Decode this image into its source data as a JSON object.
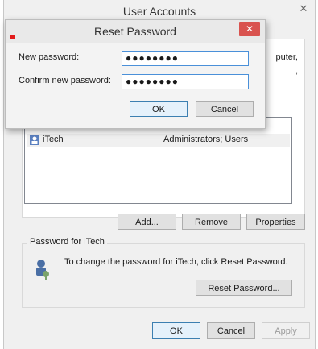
{
  "window": {
    "title": "User Accounts",
    "close_glyph": "✕"
  },
  "top_group": {
    "partial_line1": "puter,",
    "partial_line2": ","
  },
  "users": [
    {
      "name": "iTech",
      "groups": "Administrators; Users"
    }
  ],
  "buttons": {
    "add": "Add...",
    "remove": "Remove",
    "properties": "Properties"
  },
  "password_group": {
    "title": "Password for iTech",
    "text": "To change the password for iTech, click Reset Password.",
    "reset_button": "Reset Password..."
  },
  "footer": {
    "ok": "OK",
    "cancel": "Cancel",
    "apply": "Apply"
  },
  "dialog": {
    "title": "Reset Password",
    "close_glyph": "✕",
    "new_password_label": "New password:",
    "new_password_value": "●●●●●●●●",
    "confirm_password_label": "Confirm new password:",
    "confirm_password_value": "●●●●●●●●",
    "ok": "OK",
    "cancel": "Cancel"
  },
  "icons": {
    "user": "user-icon",
    "password_user": "user-key-icon"
  },
  "colors": {
    "accent_red": "#e21b1b",
    "close_red": "#d9534f",
    "focus_blue": "#4a90d9"
  }
}
